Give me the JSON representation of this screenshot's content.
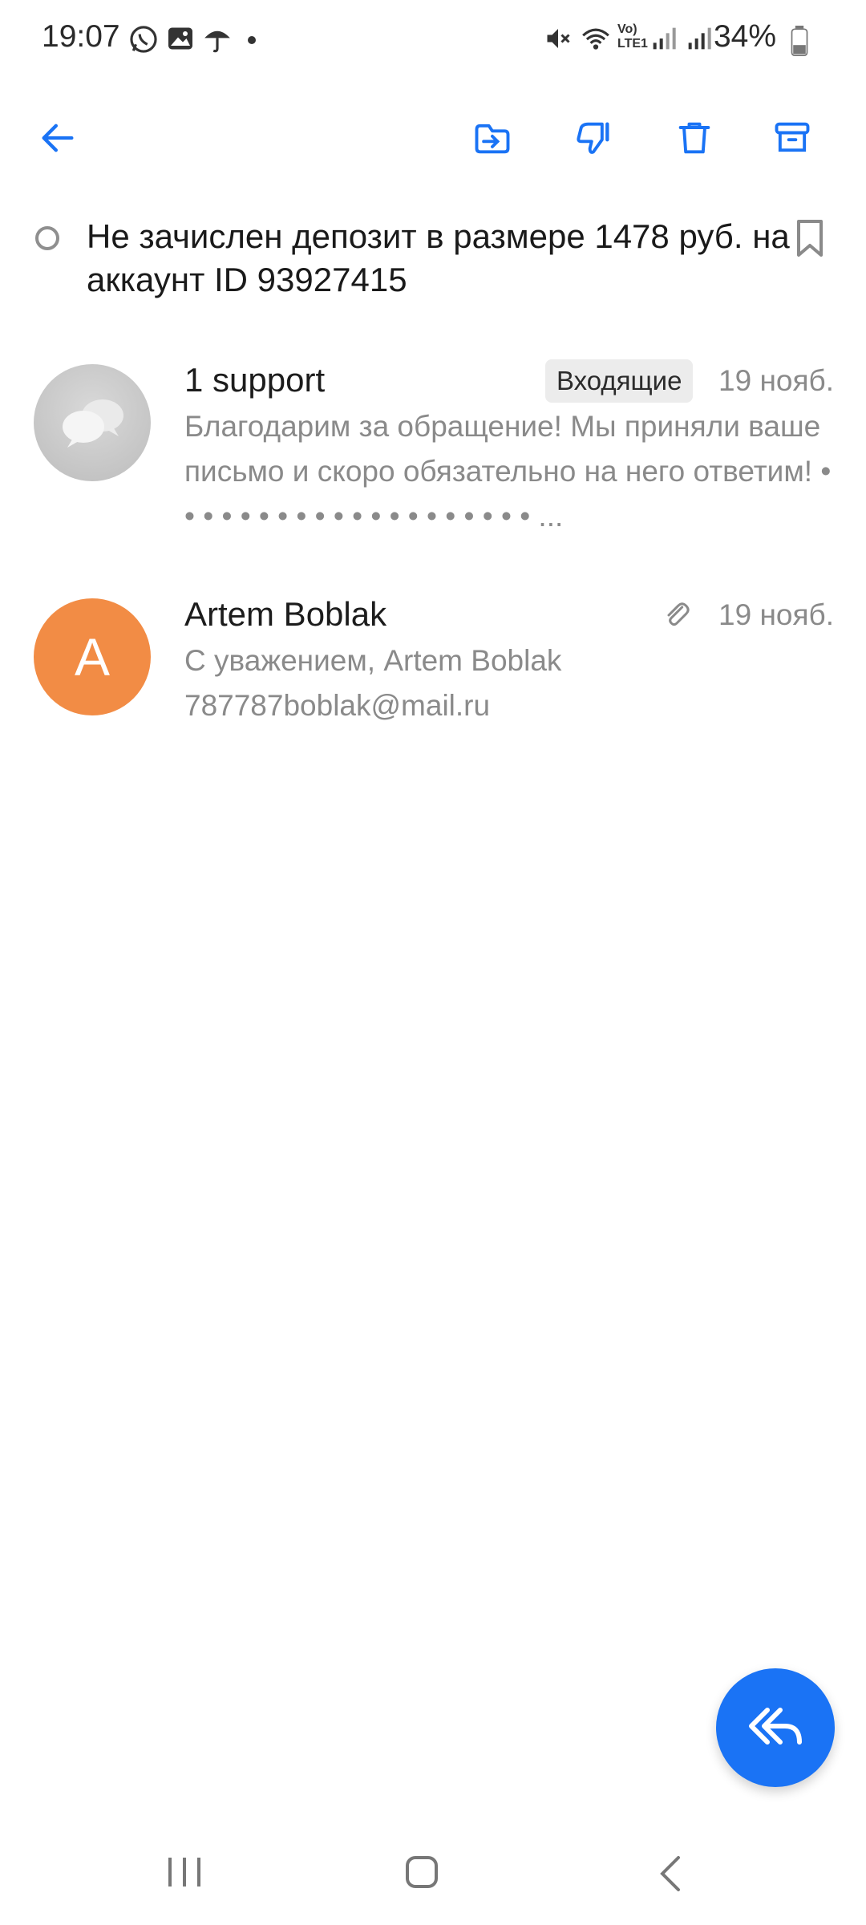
{
  "status_bar": {
    "time": "19:07",
    "battery": "34%",
    "icons": [
      "whatsapp-icon",
      "gallery-icon",
      "umbrella-icon",
      "dot-icon",
      "mute-icon",
      "wifi-icon",
      "volte-icon",
      "signal-icon",
      "signal-icon",
      "battery-icon"
    ]
  },
  "toolbar": {
    "icons": [
      "back-arrow-icon",
      "move-to-folder-icon",
      "spam-thumbs-down-icon",
      "delete-trash-icon",
      "archive-icon"
    ]
  },
  "thread": {
    "subject": "Не зачислен депозит в размере 1478 руб. на аккаунт ID 93927415"
  },
  "messages": [
    {
      "sender": "1 support",
      "folder": "Входящие",
      "date": "19 нояб.",
      "snippet": "Благодарим за обращение! Мы приняли ваше письмо и скоро обязательно на него ответим! • • • • • • • • • • • • • • • • • • • • ...",
      "avatar": "chat-bubbles-icon"
    },
    {
      "sender": "Artem Boblak",
      "date": "19 нояб.",
      "snippet": "С уважением, Artem Boblak 787787boblak@mail.ru",
      "avatar_letter": "A",
      "has_attachment": true
    }
  ],
  "colors": {
    "accent": "#1a73f5",
    "avatar_orange": "#f28c45"
  }
}
